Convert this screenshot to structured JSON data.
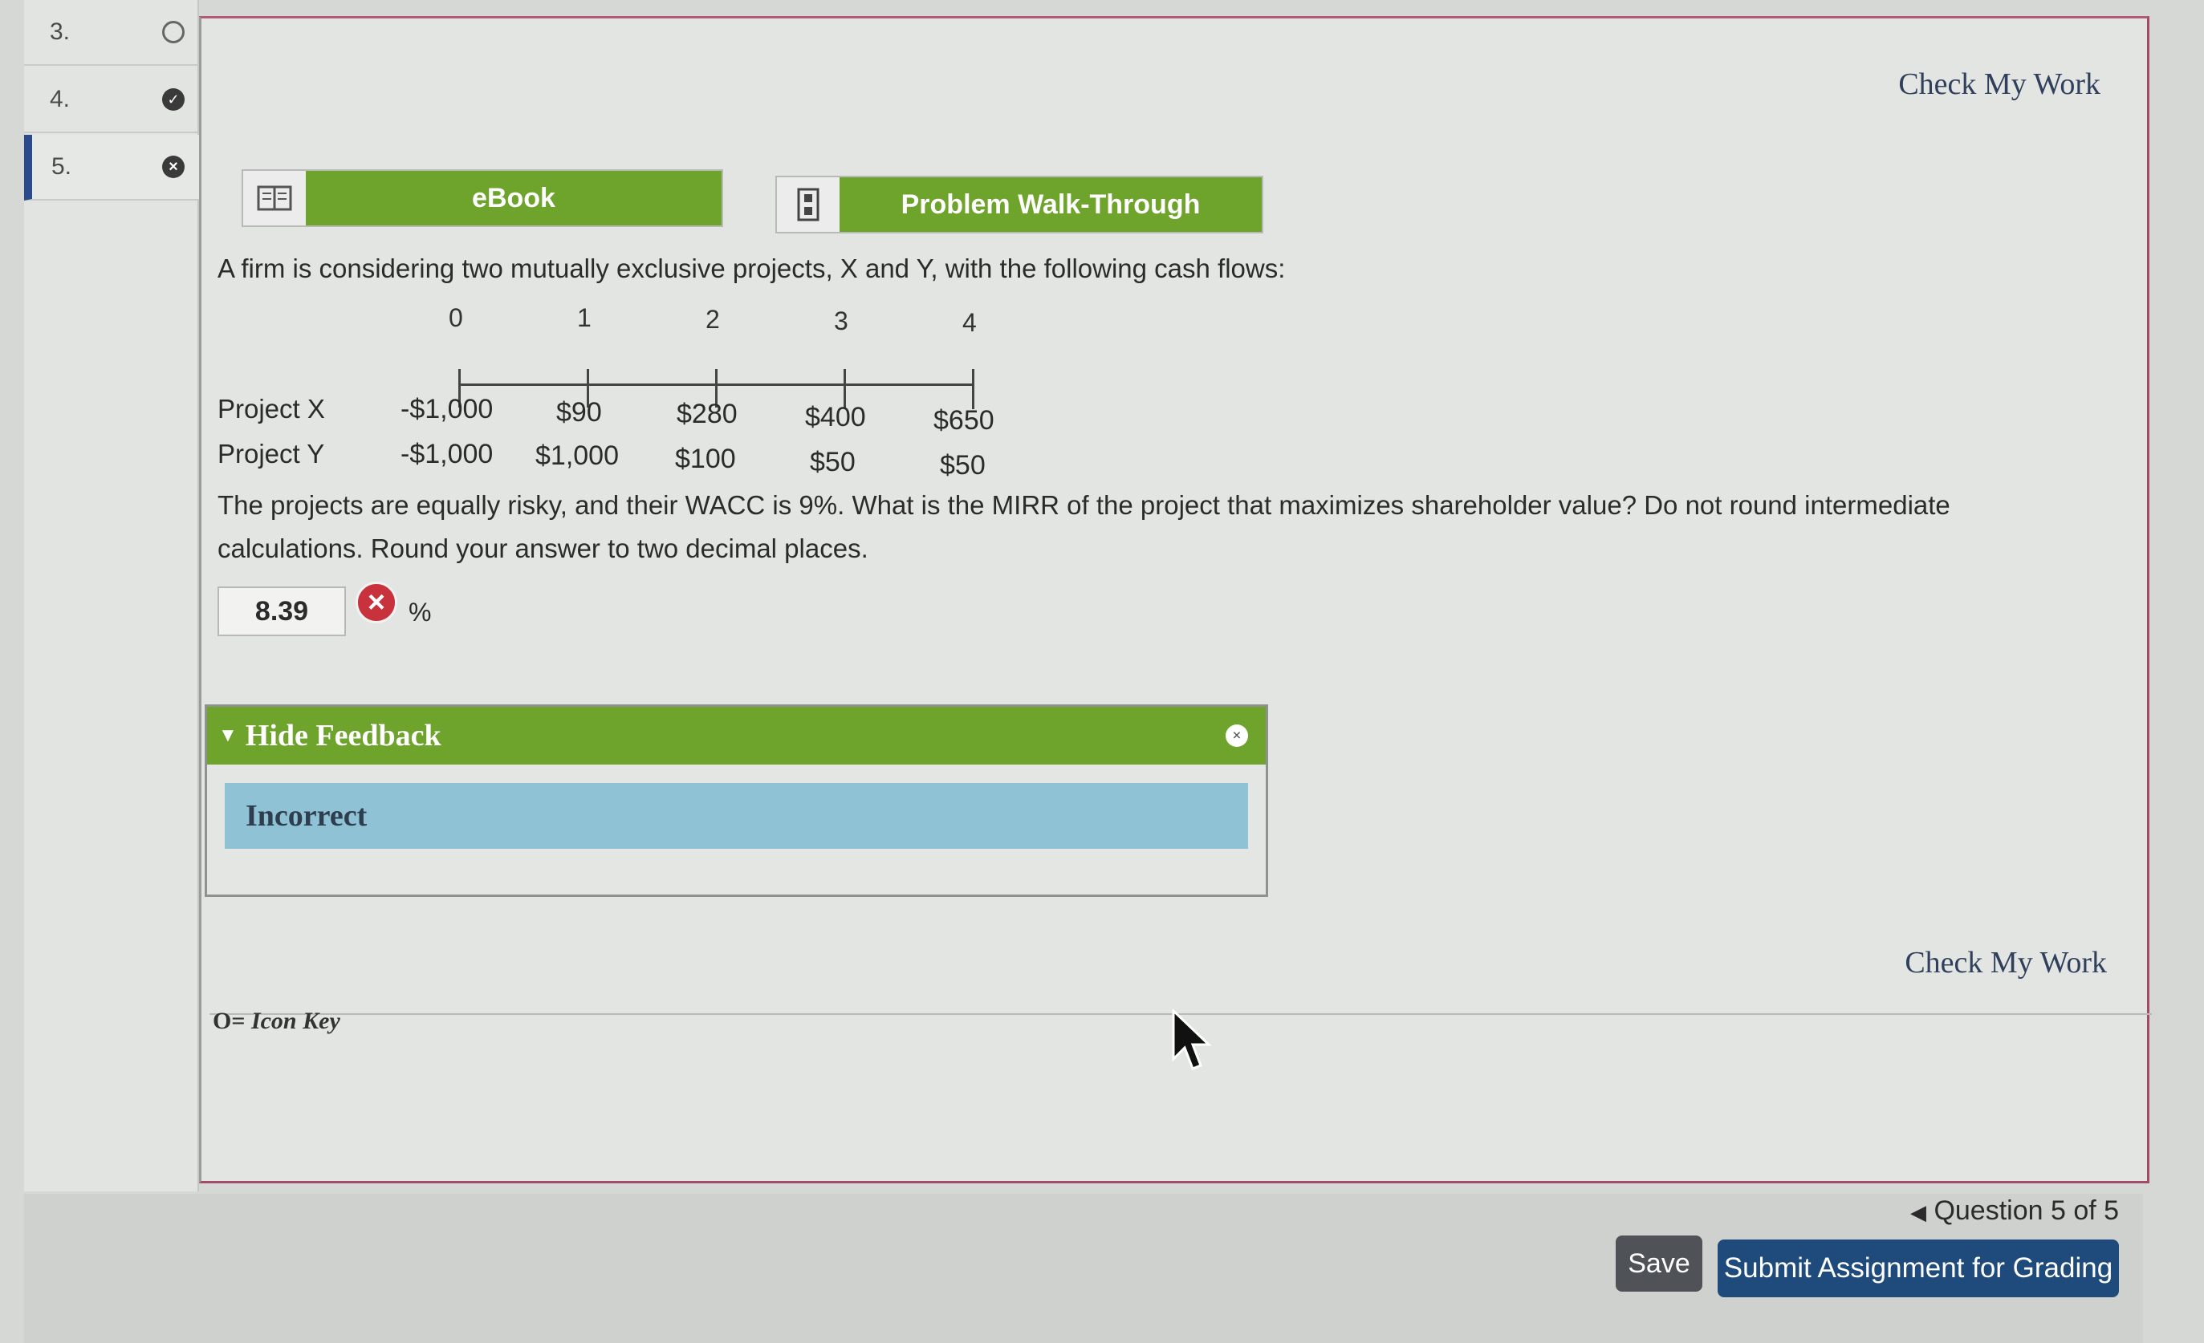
{
  "sidebar": {
    "items": [
      {
        "number": "3.",
        "status": "unanswered"
      },
      {
        "number": "4.",
        "status": "partial"
      },
      {
        "number": "5.",
        "status": "incorrect"
      }
    ]
  },
  "header": {
    "check_my_work": "Check My Work"
  },
  "tools": {
    "ebook_label": "eBook",
    "walkthrough_label": "Problem Walk-Through"
  },
  "problem": {
    "intro": "A firm is considering two mutually exclusive projects, X and Y, with the following cash flows:",
    "periods": [
      "0",
      "1",
      "2",
      "3",
      "4"
    ],
    "projects": [
      {
        "name": "Project X",
        "cash_flows": [
          "-$1,000",
          "$90",
          "$280",
          "$400",
          "$650"
        ]
      },
      {
        "name": "Project Y",
        "cash_flows": [
          "-$1,000",
          "$1,000",
          "$100",
          "$50",
          "$50"
        ]
      }
    ],
    "question_line1": "The projects are equally risky, and their WACC is 9%. What is the MIRR of the project that maximizes shareholder value? Do not round intermediate",
    "question_line2": "calculations. Round your answer to two decimal places."
  },
  "answer": {
    "value": "8.39",
    "unit": "%"
  },
  "feedback": {
    "toggle_label": "Hide Feedback",
    "result": "Incorrect"
  },
  "footer": {
    "check_my_work": "Check My Work",
    "icon_key": "Icon Key",
    "question_nav": "Question 5 of 5",
    "save_label": "Save",
    "submit_label": "Submit Assignment for Grading"
  },
  "colors": {
    "accent_green": "#6fa42c",
    "feedback_blue": "#8ec2d4",
    "submit_blue": "#1e4a7c",
    "error_red": "#c8323d"
  }
}
